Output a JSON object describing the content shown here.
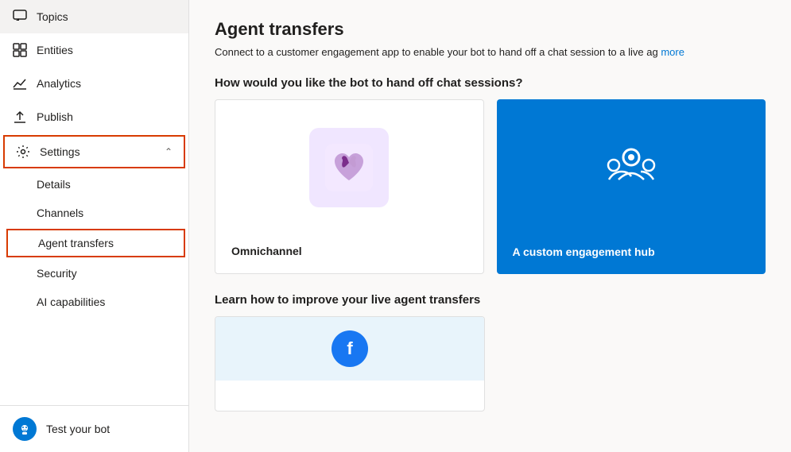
{
  "sidebar": {
    "items": [
      {
        "id": "topics",
        "label": "Topics",
        "icon": "chat-icon"
      },
      {
        "id": "entities",
        "label": "Entities",
        "icon": "grid-icon"
      },
      {
        "id": "analytics",
        "label": "Analytics",
        "icon": "analytics-icon"
      },
      {
        "id": "publish",
        "label": "Publish",
        "icon": "publish-icon"
      },
      {
        "id": "settings",
        "label": "Settings",
        "icon": "settings-icon",
        "expanded": true
      }
    ],
    "sub_items": [
      {
        "id": "details",
        "label": "Details"
      },
      {
        "id": "channels",
        "label": "Channels"
      },
      {
        "id": "agent-transfers",
        "label": "Agent transfers",
        "active": true
      },
      {
        "id": "security",
        "label": "Security"
      },
      {
        "id": "ai-capabilities",
        "label": "AI capabilities"
      }
    ],
    "bottom": {
      "label": "Test your bot"
    }
  },
  "main": {
    "title": "Agent transfers",
    "description": "Connect to a customer engagement app to enable your bot to hand off a chat session to a live ag",
    "description_link": "more",
    "section1": "How would you like the bot to hand off chat sessions?",
    "section2": "Learn how to improve your live agent transfers",
    "card1_label": "Omnichannel",
    "card2_label": "A custom engagement hub"
  }
}
